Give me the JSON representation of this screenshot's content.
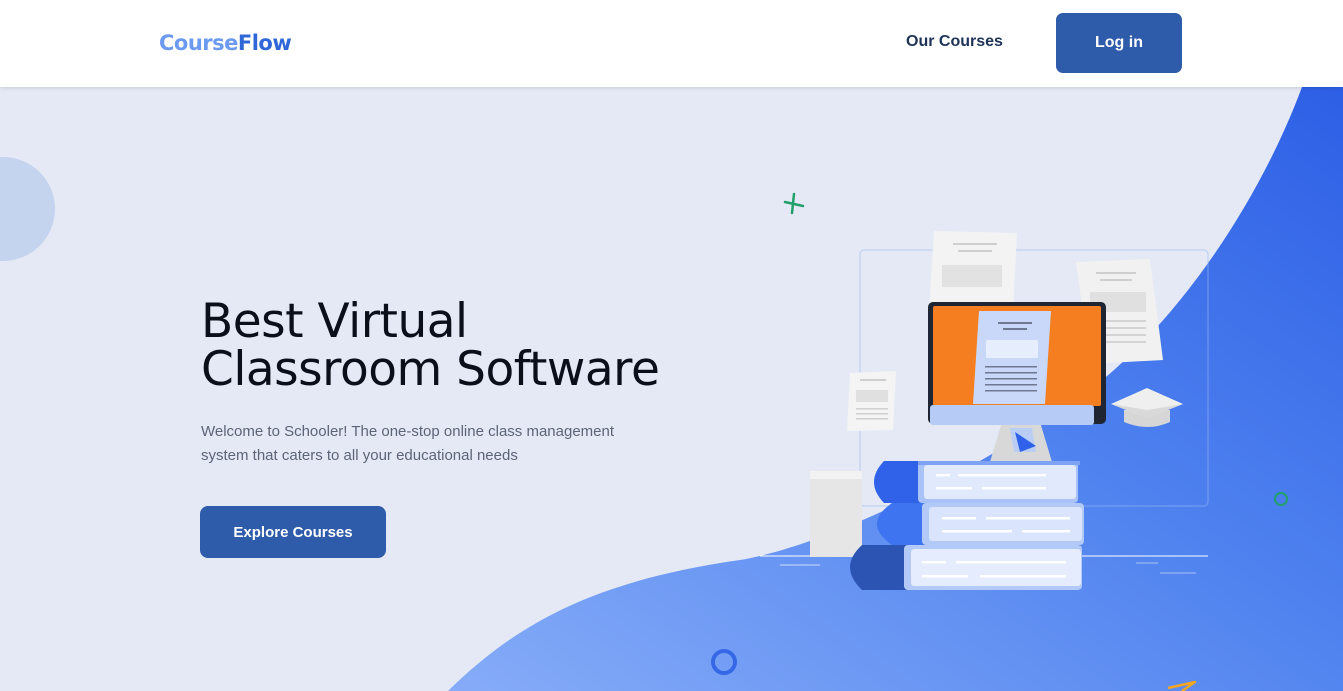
{
  "brand": {
    "name_part1": "Course",
    "name_part2": "Flow"
  },
  "nav": {
    "courses_label": "Our Courses",
    "login_label": "Log in"
  },
  "hero": {
    "title_line1": "Best Virtual",
    "title_line2": "Classroom Software",
    "subtitle": "Welcome to Schooler! The one-stop online class management system that caters to all your educational needs",
    "cta_label": "Explore Courses"
  },
  "colors": {
    "primary": "#2e5baa",
    "hero_bg": "#e4e9f5",
    "wave_light": "#7da6f7",
    "wave_dark": "#2f62e8",
    "monitor_screen": "#f57f20",
    "accent_green": "#22a06b",
    "accent_orange": "#f5a623"
  },
  "illustration": {
    "icons": [
      "plus-icon",
      "circle-icon",
      "triangle-icon",
      "graduation-cap-icon",
      "play-icon",
      "document-icon",
      "book-icon",
      "monitor-icon"
    ]
  }
}
